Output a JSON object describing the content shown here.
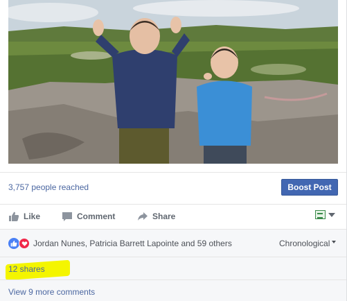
{
  "post": {
    "photo_alt": "",
    "reach_text": "3,757 people reached",
    "boost_label": "Boost Post"
  },
  "actions": {
    "like_label": "Like",
    "comment_label": "Comment",
    "share_label": "Share",
    "audience_icon": "audience-selector-icon"
  },
  "reactions": {
    "icons": [
      "like-reaction-icon",
      "love-reaction-icon"
    ],
    "names_text": "Jordan Nunes, Patricia Barrett Lapointe and 59 others",
    "sort_label": "Chronological"
  },
  "shares": {
    "text": "12 shares"
  },
  "comments": {
    "view_more_text": "View 9 more comments"
  },
  "colors": {
    "link": "#4b67a1",
    "boost": "#4267b2",
    "highlight": "#f4f500",
    "like_blue": "#4a80f5",
    "love_red": "#f0284a"
  }
}
